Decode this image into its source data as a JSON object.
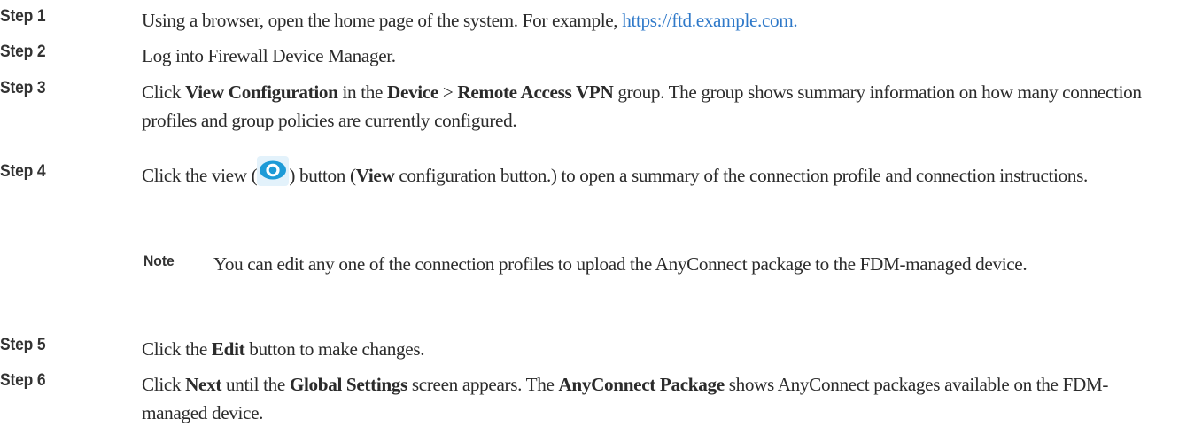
{
  "steps": [
    {
      "label": "Step 1",
      "parts": [
        {
          "text": "Using a browser, open the home page of the system. For example, "
        },
        {
          "text": "https://ftd.example.com.",
          "link": true
        }
      ]
    },
    {
      "label": "Step 2",
      "parts": [
        {
          "text": "Log into Firewall Device Manager."
        }
      ]
    },
    {
      "label": "Step 3",
      "parts": [
        {
          "text": "Click "
        },
        {
          "text": "View Configuration",
          "bold": true
        },
        {
          "text": " in the "
        },
        {
          "text": "Device",
          "bold": true
        },
        {
          "text": " > "
        },
        {
          "text": "Remote Access VPN",
          "bold": true
        },
        {
          "text": " group. The group shows summary information on how many connection profiles and group policies are currently configured."
        }
      ]
    },
    {
      "label": "Step 4",
      "parts": [
        {
          "text": "Click the view ("
        },
        {
          "icon": "eye-icon"
        },
        {
          "text": ") button ("
        },
        {
          "text": "View",
          "bold": true
        },
        {
          "text": " configuration button.) to open a summary of the connection profile and connection instructions."
        }
      ]
    },
    {
      "label": "Step 5",
      "parts": [
        {
          "text": "Click the "
        },
        {
          "text": "Edit",
          "bold": true
        },
        {
          "text": " button to make changes."
        }
      ]
    },
    {
      "label": "Step 6",
      "parts": [
        {
          "text": "Click "
        },
        {
          "text": "Next",
          "bold": true
        },
        {
          "text": " until the "
        },
        {
          "text": "Global Settings",
          "bold": true
        },
        {
          "text": " screen appears. The "
        },
        {
          "text": "AnyConnect Package",
          "bold": true
        },
        {
          "text": " shows AnyConnect packages available on the FDM-managed device."
        }
      ]
    }
  ],
  "note": {
    "label": "Note",
    "text": "You can edit any one of the connection profiles to upload the AnyConnect package to the FDM-managed device."
  },
  "colors": {
    "link": "#2f79c9",
    "eye_icon": "#1e9bd7",
    "text": "#2b2b2b"
  }
}
